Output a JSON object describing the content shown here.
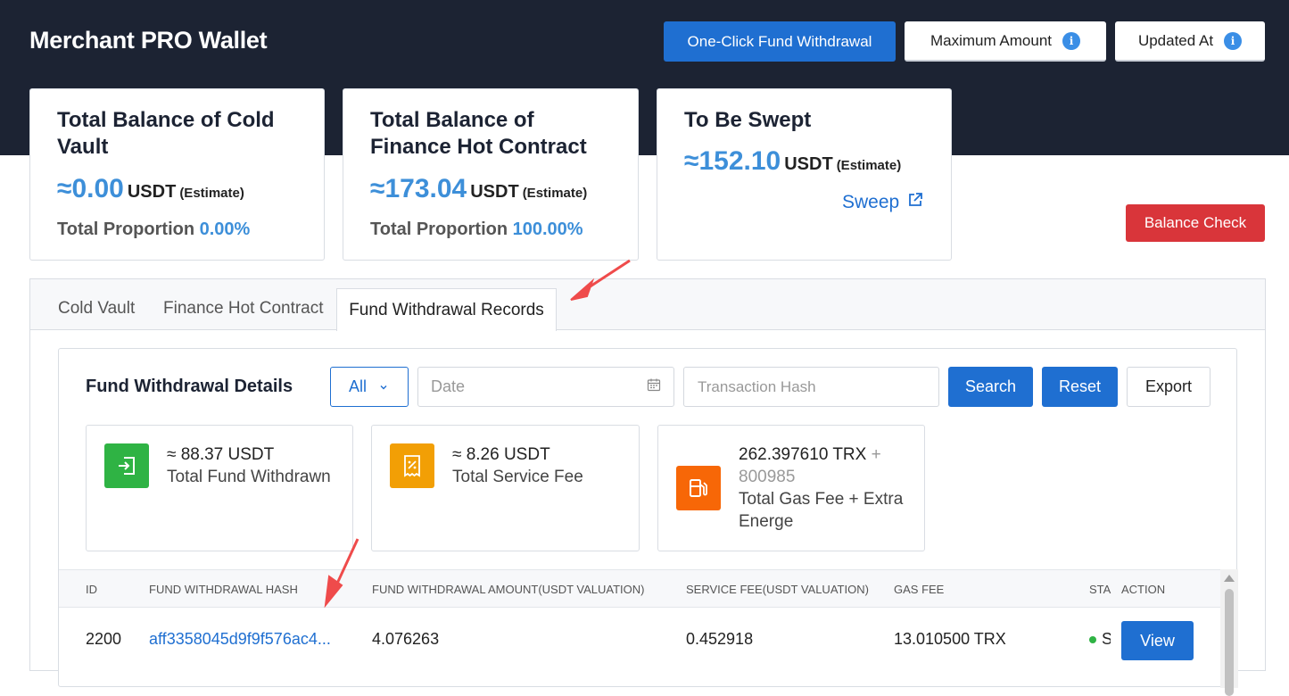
{
  "header": {
    "title": "Merchant PRO Wallet",
    "withdraw_btn": "One-Click Fund Withdrawal",
    "max_btn": "Maximum Amount",
    "updated_btn": "Updated At"
  },
  "cards": [
    {
      "title": "Total Balance of Cold Vault",
      "value": "≈0.00",
      "unit": "USDT",
      "est": "(Estimate)",
      "prop_label": "Total Proportion",
      "prop_value": "0.00%"
    },
    {
      "title": "Total Balance of Finance Hot Contract",
      "value": "≈173.04",
      "unit": "USDT",
      "est": "(Estimate)",
      "prop_label": "Total Proportion",
      "prop_value": "100.00%"
    },
    {
      "title": "To Be Swept",
      "value": "≈152.10",
      "unit": "USDT",
      "est": "(Estimate)",
      "link": "Sweep"
    }
  ],
  "balance_check": "Balance Check",
  "tabs": [
    "Cold Vault",
    "Finance Hot Contract",
    "Fund Withdrawal Records"
  ],
  "details": {
    "title": "Fund Withdrawal Details",
    "filter_value": "All",
    "date_placeholder": "Date",
    "hash_placeholder": "Transaction Hash",
    "search": "Search",
    "reset": "Reset",
    "export": "Export"
  },
  "stats": [
    {
      "value": "≈ 88.37 USDT",
      "label": "Total Fund Withdrawn",
      "color": "#2fb344"
    },
    {
      "value": "≈ 8.26 USDT",
      "label": "Total Service Fee",
      "color": "#f29f05"
    },
    {
      "value": "262.397610 TRX",
      "extra": "+ 800985",
      "label": "Total Gas Fee + Extra Energe",
      "color": "#f76707"
    }
  ],
  "table": {
    "headers": [
      "ID",
      "FUND WITHDRAWAL HASH",
      "FUND WITHDRAWAL AMOUNT(USDT VALUATION)",
      "SERVICE FEE(USDT VALUATION)",
      "GAS FEE",
      "STA",
      "ACTION"
    ],
    "rows": [
      {
        "id": "2200",
        "hash": "aff3358045d9f9f576ac4...",
        "amount": "4.076263",
        "fee": "0.452918",
        "gas": "13.010500 TRX",
        "status": "S",
        "action": "View"
      }
    ]
  },
  "colors": {
    "primary": "#1f6fd1",
    "danger": "#d9353a",
    "header_bg": "#1c2333",
    "accent": "#3d8fd9"
  }
}
